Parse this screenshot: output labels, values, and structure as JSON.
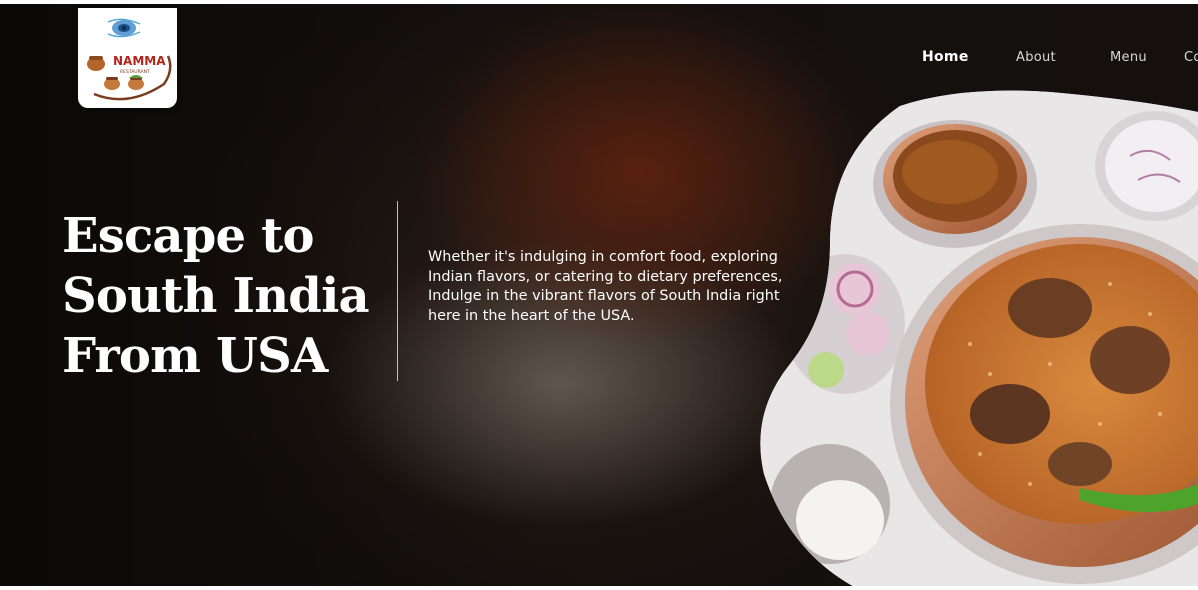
{
  "logo": {
    "brand": "NAMMA",
    "tagline": "RESTAURANT"
  },
  "nav": {
    "items": [
      "Home",
      "About",
      "Menu",
      "Co"
    ],
    "active": "Home"
  },
  "hero": {
    "headline_lines": [
      "Escape to",
      "South India",
      "From USA"
    ],
    "description": "Whether it's indulging in comfort food, exploring Indian flavors, or catering to dietary preferences, Indulge in the vibrant flavors of South India right here in the heart of the USA."
  },
  "colors": {
    "brand_red": "#b0261c",
    "brand_brown": "#7a3b1e",
    "text": "#ffffff",
    "hero_bg": "#1a1513"
  }
}
